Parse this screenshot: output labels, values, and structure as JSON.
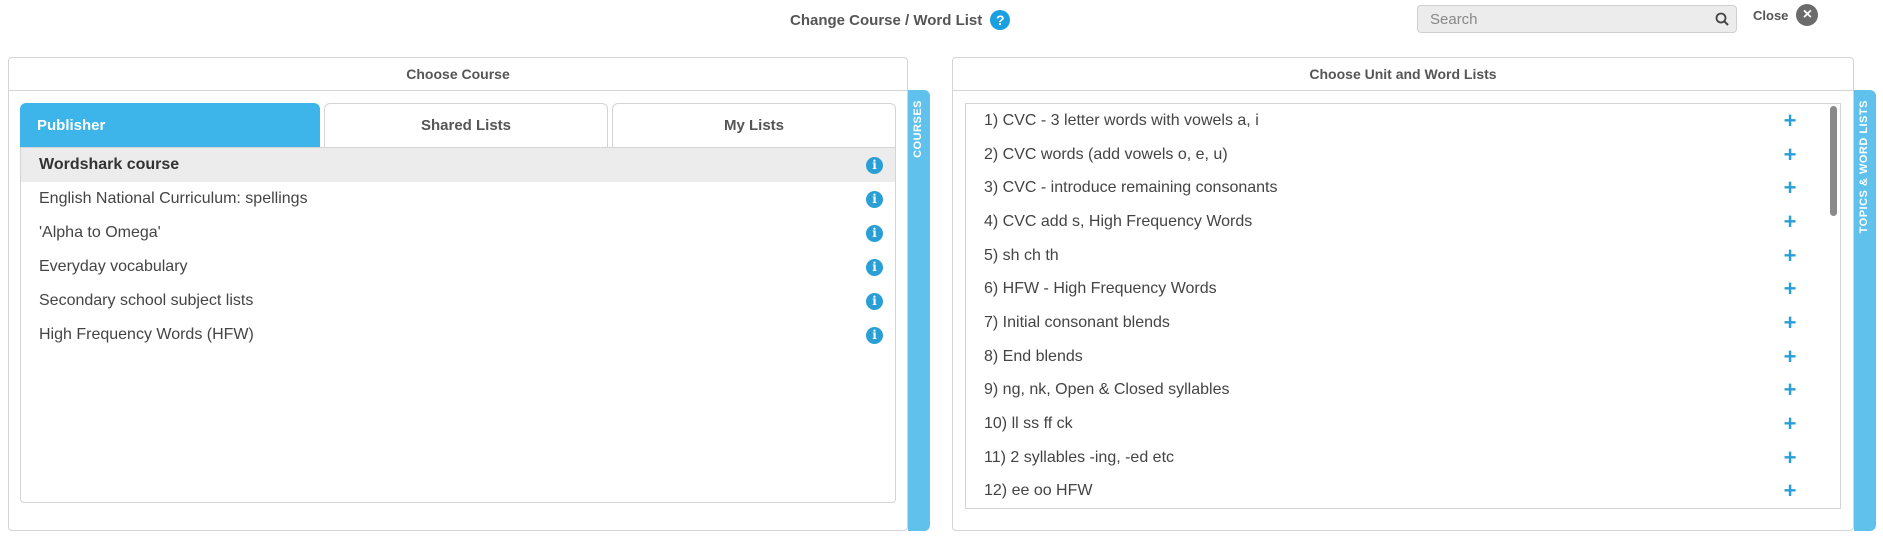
{
  "header": {
    "title": "Change Course / Word List",
    "help_glyph": "?",
    "search_placeholder": "Search",
    "close_label": "Close",
    "close_glyph": "×"
  },
  "left_panel": {
    "title": "Choose Course",
    "side_tab_label": "COURSES",
    "tabs": [
      {
        "label": "Publisher",
        "active": true
      },
      {
        "label": "Shared Lists",
        "active": false
      },
      {
        "label": "My Lists",
        "active": false
      }
    ],
    "courses": [
      {
        "label": "Wordshark course",
        "selected": true
      },
      {
        "label": "English National Curriculum: spellings",
        "selected": false
      },
      {
        "label": "'Alpha to Omega'",
        "selected": false
      },
      {
        "label": "Everyday vocabulary",
        "selected": false
      },
      {
        "label": "Secondary school subject lists",
        "selected": false
      },
      {
        "label": "High Frequency Words (HFW)",
        "selected": false
      }
    ],
    "info_glyph": "i"
  },
  "right_panel": {
    "title": "Choose Unit and Word Lists",
    "side_tab_label": "TOPICS & WORD LISTS",
    "plus_glyph": "+",
    "units": [
      "1) CVC - 3 letter words with vowels a, i",
      "2) CVC words (add vowels o, e, u)",
      "3) CVC - introduce remaining consonants",
      "4) CVC add s, High Frequency Words",
      "5) sh ch th",
      "6) HFW - High Frequency Words",
      "7) Initial consonant blends",
      "8) End blends",
      "9) ng, nk, Open & Closed syllables",
      "10) ll ss ff ck",
      "11) 2 syllables -ing, -ed etc",
      "12) ee oo HFW"
    ]
  },
  "colors": {
    "accent": "#3db5ea",
    "side_tab": "#5fc1ec",
    "icon_blue": "#2a9fd6"
  }
}
